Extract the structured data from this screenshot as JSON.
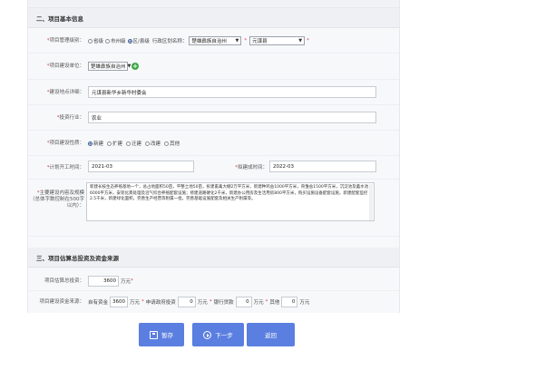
{
  "section2": {
    "title": "二、项目基本信息",
    "admin_level": {
      "label": "项目管理级别：",
      "options": [
        "省级",
        "市州级",
        "区/县级"
      ],
      "selected": "区/县级",
      "region_label": "行政区划名称：",
      "region_city": "楚雄彝族自治州",
      "region_county": "元谋县"
    },
    "unit": {
      "label": "项目建设单位：",
      "value": "楚雄彝族自治州"
    },
    "location": {
      "label": "建设地点详细：",
      "value": "元谋县新华乡新华村委会"
    },
    "industry": {
      "label": "投资行业：",
      "value": "农业"
    },
    "nature": {
      "label": "项目建设性质：",
      "options": [
        "新建",
        "扩建",
        "迁建",
        "改建",
        "其他"
      ],
      "selected": "新建"
    },
    "start": {
      "label": "计划开工时间：",
      "value": "2021-03"
    },
    "end": {
      "label": "拟建成时间：",
      "value": "2022-03"
    },
    "scope": {
      "label": "主要建设内容及规模（总体字数控制在500字以内）：",
      "value": "新建长枝生态养殖基地一个，总占地面积50亩，平整土地50亩，拆建畜禽大棚2万平方米，新建种鸡舍1000平方米，育雏舍1500平方米，沉淀池及蓄水池6000平方米，安装化粪处理及沼气综合养殖配套设施；修建道路硬化2千米，新建办公用房及生活用房800平方米，购买设施设备配套设施，新建配套监控2.5千米，新建绿化面积，完善生产经营等附属一批，完善基础设施配套及相关生产附属等。"
    }
  },
  "section3": {
    "title": "三、项目估算总投资及资金来源",
    "total": {
      "label": "项目估算总投资：",
      "value": "3600",
      "unit": "万元"
    },
    "sources": {
      "label": "项目建设资金来源：",
      "self_label": "自有资金",
      "self_value": "3600",
      "unit": "万元",
      "fiscal_label": "申请政府投资",
      "fiscal_value": "0",
      "loan_label": "银行贷款",
      "loan_value": "0",
      "other_label": "其他",
      "other_value": "0"
    }
  },
  "buttons": {
    "save": "暂存",
    "next": "下一步",
    "back": "返回"
  },
  "colors": {
    "button": "#5b7fe0",
    "required": "#e03a3a",
    "add": "#3aa645"
  }
}
